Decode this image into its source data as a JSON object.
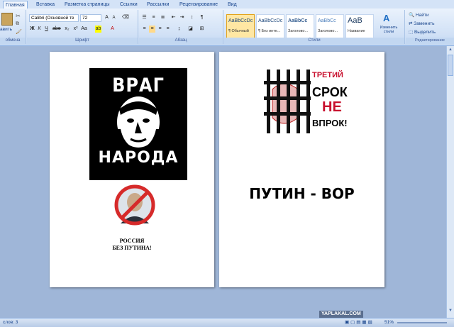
{
  "tabs": [
    "Главная",
    "Вставка",
    "Разметка страницы",
    "Ссылки",
    "Рассылки",
    "Рецензирование",
    "Вид"
  ],
  "clipboard": {
    "paste_label": "авить",
    "group_label": "обмена"
  },
  "font": {
    "name": "Calibri (Основной те",
    "size": "72",
    "group_label": "Шрифт"
  },
  "paragraph": {
    "group_label": "Абзац"
  },
  "styles": {
    "group_label": "Стили",
    "items": [
      {
        "sample": "AaBbCcDc",
        "name": "¶ Обычный"
      },
      {
        "sample": "AaBbCcDc",
        "name": "¶ Без инте..."
      },
      {
        "sample": "AaBbCc",
        "name": "Заголово..."
      },
      {
        "sample": "AaBbCc",
        "name": "Заголово..."
      },
      {
        "sample": "AaB",
        "name": "Название"
      }
    ],
    "change_label": "Изменить стили"
  },
  "editing": {
    "find": "Найти",
    "replace": "Заменить",
    "select": "Выделить",
    "group_label": "Редактирование"
  },
  "page1": {
    "poster_top": "ВРАГ",
    "poster_bottom": "НАРОДА",
    "caption1": "РОССИЯ",
    "caption2": "БЕЗ ПУТИНА!"
  },
  "page2": {
    "poster_line1": "ТРЕТИЙ",
    "poster_line2": "СРОК",
    "poster_line3": "НЕ",
    "poster_line4": "ВПРОК!",
    "heading": "ПУТИН - ВОР"
  },
  "status": {
    "words": "слов: 3",
    "zoom": "51%",
    "watermark": "YAPLAKAL.COM"
  }
}
